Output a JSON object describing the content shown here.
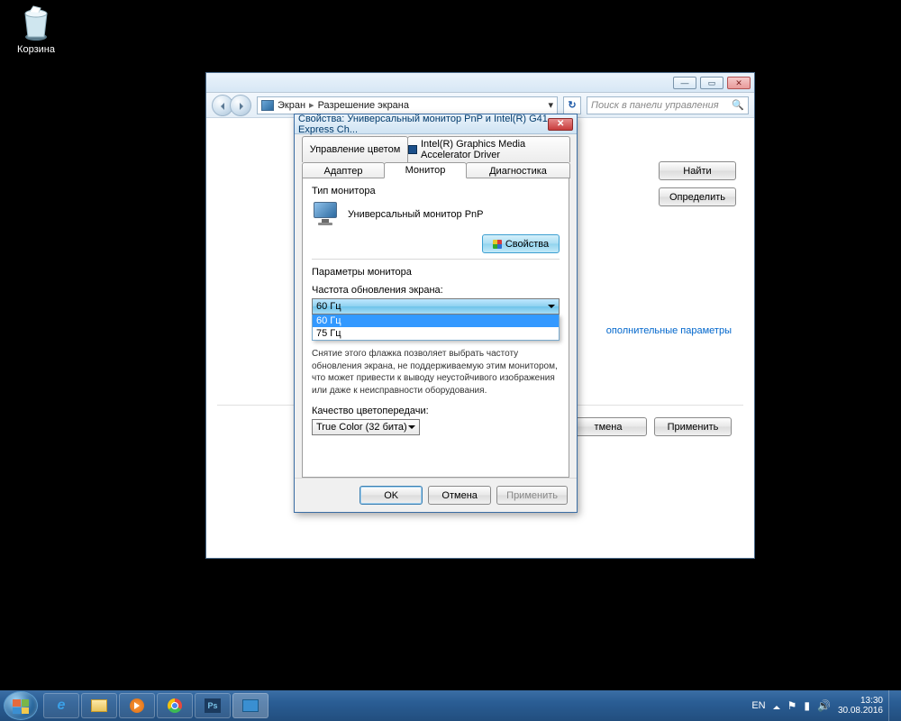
{
  "desktop": {
    "recycle_bin": "Корзина"
  },
  "explorer": {
    "breadcrumb": {
      "root": "Экран",
      "page": "Разрешение экрана"
    },
    "search_placeholder": "Поиск в панели управления",
    "buttons": {
      "find": "Найти",
      "identify": "Определить"
    },
    "advanced_link": "ополнительные параметры",
    "bottom": {
      "cancel": "тмена",
      "apply": "Применить"
    }
  },
  "dialog": {
    "title": "Свойства: Универсальный монитор PnP и Intel(R) G41 Express Ch...",
    "tabs": {
      "color_mgmt": "Управление цветом",
      "intel": "Intel(R) Graphics Media Accelerator Driver",
      "adapter": "Адаптер",
      "monitor": "Монитор",
      "diagnostics": "Диагностика"
    },
    "monitor_type_label": "Тип монитора",
    "monitor_name": "Универсальный монитор PnP",
    "properties_btn": "Свойства",
    "params_label": "Параметры монитора",
    "refresh_label": "Частота обновления экрана:",
    "refresh_selected": "60 Гц",
    "refresh_options": [
      "60 Гц",
      "75 Гц"
    ],
    "hint": "Снятие этого флажка позволяет выбрать частоту обновления экрана, не поддерживаемую этим монитором, что может привести к выводу неустойчивого изображения или даже к неисправности оборудования.",
    "quality_label": "Качество цветопередачи:",
    "quality_value": "True Color (32 бита)",
    "buttons": {
      "ok": "OK",
      "cancel": "Отмена",
      "apply": "Применить"
    }
  },
  "taskbar": {
    "lang": "EN",
    "time": "13:30",
    "date": "30.08.2016"
  }
}
